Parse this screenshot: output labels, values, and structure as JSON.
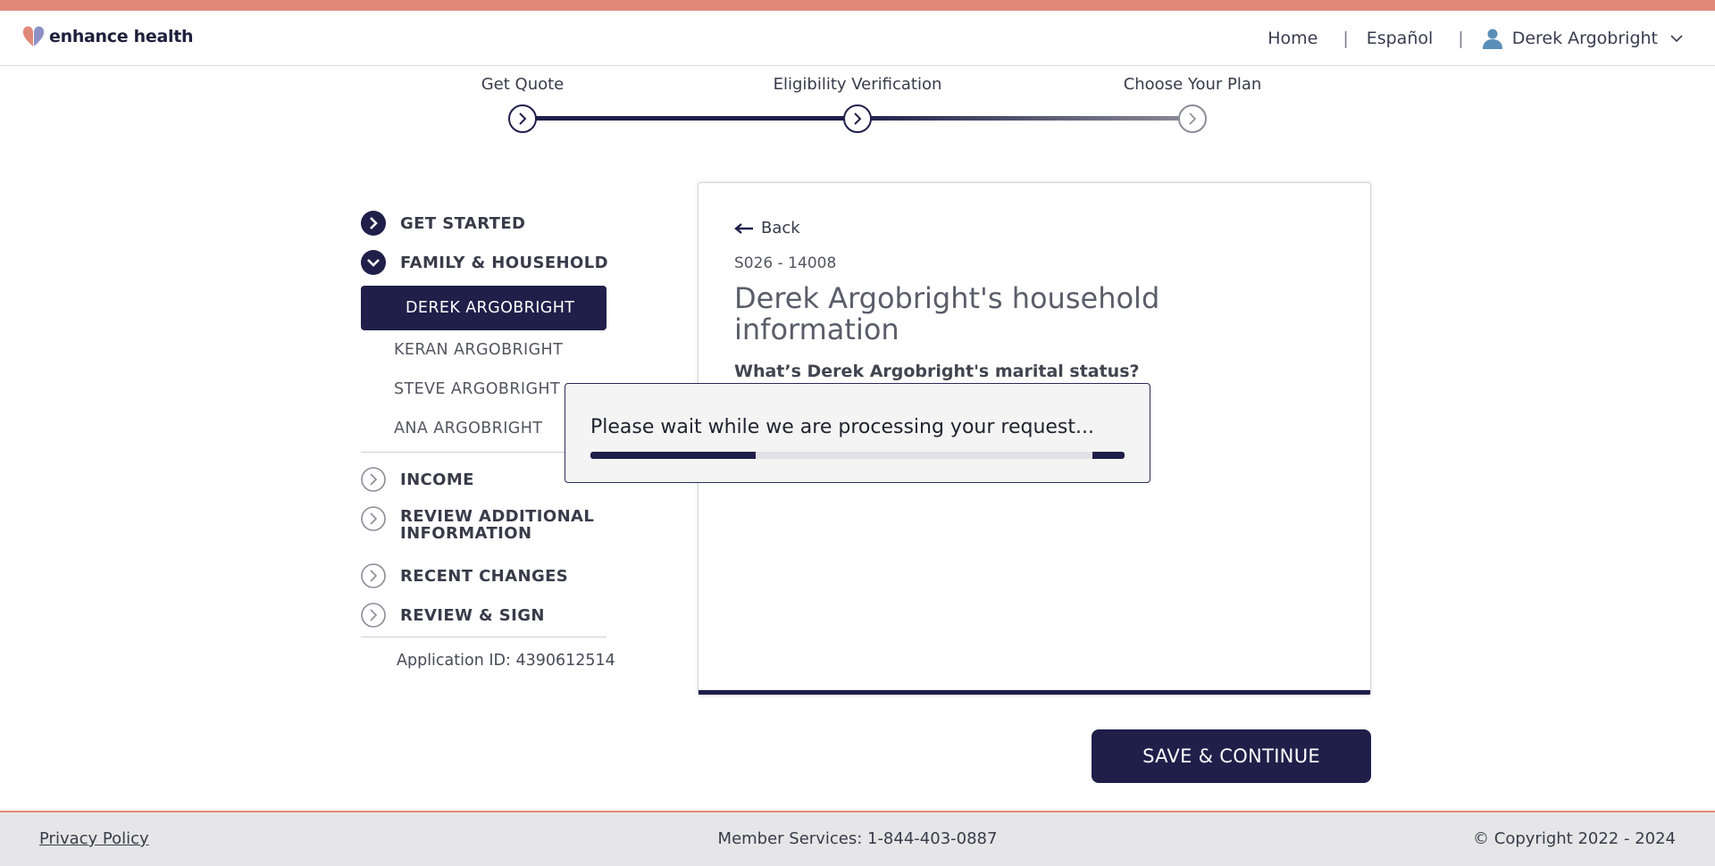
{
  "brand": {
    "name": "enhance health",
    "stripe_color": "#e08878",
    "primary_color": "#1f1f4a"
  },
  "header": {
    "nav_home": "Home",
    "nav_language": "Español",
    "separator": "|",
    "user_name": "Derek Argobright"
  },
  "stepper": {
    "steps": [
      {
        "label": "Get Quote",
        "state": "complete"
      },
      {
        "label": "Eligibility Verification",
        "state": "current"
      },
      {
        "label": "Choose Your Plan",
        "state": "upcoming"
      }
    ]
  },
  "sidebar": {
    "sections": [
      {
        "label": "GET STARTED",
        "icon": "chevron-right-filled-icon"
      },
      {
        "label": "FAMILY & HOUSEHOLD",
        "icon": "chevron-down-filled-icon",
        "members": [
          "DEREK ARGOBRIGHT",
          "KERAN ARGOBRIGHT",
          "STEVE ARGOBRIGHT",
          "ANA ARGOBRIGHT"
        ]
      },
      {
        "label": "INCOME",
        "icon": "chevron-right-outline-icon"
      },
      {
        "label": "REVIEW ADDITIONAL INFORMATION",
        "icon": "chevron-right-outline-icon"
      },
      {
        "label": "RECENT CHANGES",
        "icon": "chevron-right-outline-icon"
      },
      {
        "label": "REVIEW & SIGN",
        "icon": "chevron-right-outline-icon"
      }
    ],
    "application_id": "Application ID: 4390612514"
  },
  "card": {
    "back_label": "Back",
    "code": "S026 - 14008",
    "title": "Derek Argobright's household information",
    "question": "What’s Derek Argobright's marital status?"
  },
  "modal": {
    "message": "Please wait while we are processing your request...",
    "progress": 0.31
  },
  "actions": {
    "save_continue": "SAVE & CONTINUE"
  },
  "footer": {
    "privacy": "Privacy Policy",
    "member_services": "Member Services: 1-844-403-0887",
    "copyright": "© Copyright 2022 - 2024"
  }
}
